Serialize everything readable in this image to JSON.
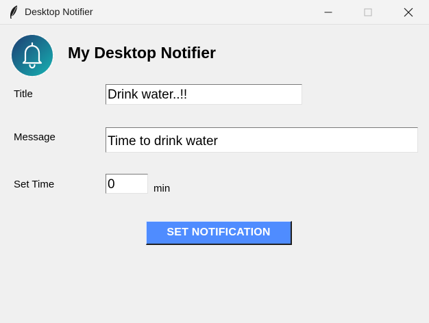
{
  "window": {
    "title": "Desktop Notifier",
    "icon": "feather-icon",
    "controls": [
      "minimize-icon",
      "maximize-icon",
      "close-icon"
    ]
  },
  "header": {
    "logo_icon": "bell-icon",
    "title": "My Desktop Notifier"
  },
  "form": {
    "title_label": "Title",
    "title_value": "Drink water..!!",
    "message_label": "Message",
    "message_value": "Time to drink water",
    "time_label": "Set Time",
    "time_value": "0",
    "time_unit": "min"
  },
  "actions": {
    "submit_label": "SET NOTIFICATION"
  },
  "colors": {
    "button_bg": "#4f8cff",
    "button_text": "#ffffff",
    "window_bg": "#f0f0f0",
    "logo_gradient_start": "#1e3c72",
    "logo_gradient_end": "#16b3b3"
  }
}
